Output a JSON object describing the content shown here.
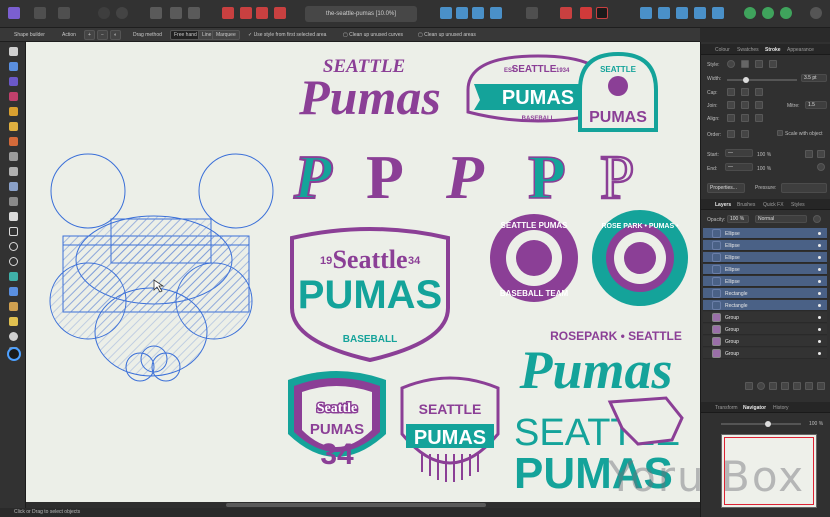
{
  "app": {
    "document_title": "the-seattle-pumas [10.0%]"
  },
  "context_bar": {
    "tool_name": "Shape builder",
    "action_label": "Action",
    "drag_method_label": "Drag method",
    "freehand_label": "Free hand",
    "line_label": "Line",
    "marquee_label": "Marquee",
    "option1": "Use style from first selected area",
    "option2": "Clean up unused curves",
    "option3": "Clean up unused areas"
  },
  "status_bar": {
    "hint": "Click or Drag to select objects"
  },
  "canvas": {
    "logo1": {
      "line1": "SEATTLE",
      "line2": "Pumas"
    },
    "logo2": {
      "est": "EST.",
      "seattle": "SEATTLE",
      "year": "1934",
      "pumas": "PUMAS",
      "sub": "BASEBALL"
    },
    "logo3": {
      "seattle": "SEATTLE",
      "pumas": "PUMAS"
    },
    "p_letters": [
      "P",
      "P",
      "P",
      "P",
      "P"
    ],
    "shield": {
      "n1": "19",
      "n2": "34",
      "seattle": "Seattle",
      "pumas": "PUMAS",
      "sub": "BASEBALL"
    },
    "circle1": {
      "top": "SEATTLE PUMAS",
      "bottom": "BASEBALL TEAM"
    },
    "circle2": {
      "ring": "ROSE PARK • PUMAS •"
    },
    "script_logo": {
      "top": "ROSEPARK • SEATTLE",
      "word": "Pumas"
    },
    "badge1": {
      "seattle": "Seattle",
      "pumas": "PUMAS",
      "num": "34"
    },
    "badge2": {
      "seattle": "SEATTLE",
      "pumas": "PUMAS"
    },
    "word_logo": {
      "seattle": "SEATTLE",
      "pumas": "PUMAS"
    }
  },
  "stroke_panel": {
    "tabs": [
      "Colour",
      "Swatches",
      "Stroke",
      "Appearance"
    ],
    "active_tab": "Stroke",
    "style_label": "Style:",
    "width_label": "Width:",
    "width_value": "3.5 pt",
    "cap_label": "Cap:",
    "join_label": "Join:",
    "mitre_label": "Mitre:",
    "mitre_value": "1.5",
    "align_label": "Align:",
    "order_label": "Order:",
    "scale_label": "Scale with object",
    "start_label": "Start:",
    "end_label": "End:",
    "start_pct": "100 %",
    "end_pct": "100 %",
    "properties_button": "Properties...",
    "pressure_label": "Pressure:"
  },
  "layers_panel": {
    "tabs": [
      "Layers",
      "Brushes",
      "Quick FX",
      "Styles"
    ],
    "active_tab": "Layers",
    "opacity_label": "Opacity:",
    "opacity_value": "100 %",
    "blend_mode": "Normal",
    "rows": [
      {
        "name": "Ellipse",
        "selected": true
      },
      {
        "name": "Ellipse",
        "selected": true
      },
      {
        "name": "Ellipse",
        "selected": true
      },
      {
        "name": "Ellipse",
        "selected": true
      },
      {
        "name": "Ellipse",
        "selected": true
      },
      {
        "name": "Rectangle",
        "selected": true
      },
      {
        "name": "Rectangle",
        "selected": true
      },
      {
        "name": "Group",
        "selected": false
      },
      {
        "name": "Group",
        "selected": false
      },
      {
        "name": "Group",
        "selected": false
      },
      {
        "name": "Group",
        "selected": false
      }
    ]
  },
  "nav_panel": {
    "tabs": [
      "Transform",
      "Navigator",
      "History"
    ],
    "active_tab": "Navigator",
    "zoom_value": "100 %"
  },
  "watermark": "Yoru Box",
  "colors": {
    "purple": "#8b3f96",
    "teal": "#14a39a",
    "canvas_bg": "#ecefe8",
    "selection_blue": "#3a6fd8",
    "layer_selected": "#4a6186"
  }
}
